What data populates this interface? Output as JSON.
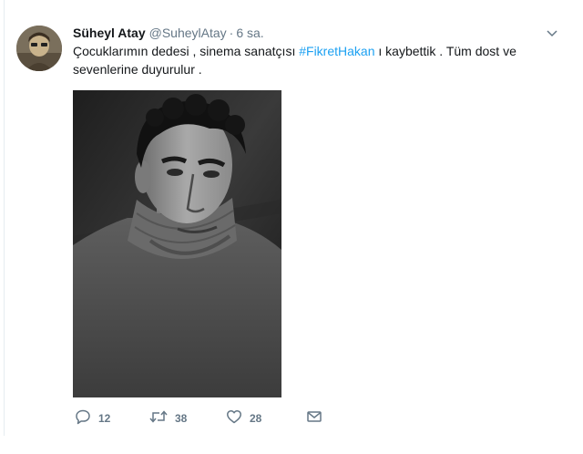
{
  "tweet": {
    "author_name": "Süheyl Atay",
    "author_handle": "@SuheylAtay",
    "separator": "·",
    "timestamp": "6 sa.",
    "text_before": "Çocuklarımın dedesi , sinema sanatçısı ",
    "hashtag": "#FikretHakan",
    "text_after": " ı kaybettik . Tüm dost ve sevenlerine duyurulur ."
  },
  "actions": {
    "reply_count": "12",
    "retweet_count": "38",
    "like_count": "28"
  },
  "icons": {
    "reply": "reply-icon",
    "retweet": "retweet-icon",
    "like": "heart-icon",
    "message": "envelope-icon",
    "menu": "chevron-down-icon"
  },
  "colors": {
    "link": "#1da1f2",
    "secondary_text": "#657786",
    "primary_text": "#14171a"
  }
}
